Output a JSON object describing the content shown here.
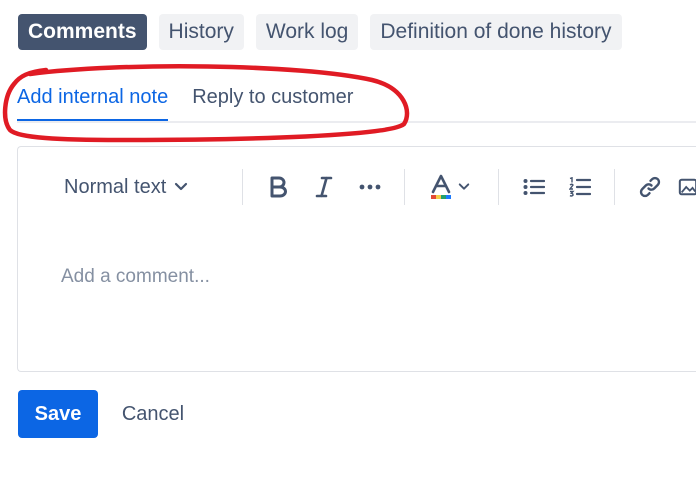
{
  "top_tabs": [
    {
      "label": "Comments",
      "active": true
    },
    {
      "label": "History",
      "active": false
    },
    {
      "label": "Work log",
      "active": false
    },
    {
      "label": "Definition of done history",
      "active": false
    }
  ],
  "sub_tabs": [
    {
      "label": "Add internal note",
      "active": true
    },
    {
      "label": "Reply to customer",
      "active": false
    }
  ],
  "editor": {
    "text_style": "Normal text",
    "placeholder": "Add a comment...",
    "toolbar_icons": [
      "chevron-down-icon",
      "bold-icon",
      "italic-icon",
      "more-icon",
      "text-color-icon",
      "bullet-list-icon",
      "numbered-list-icon",
      "link-icon",
      "image-icon"
    ]
  },
  "actions": {
    "save_label": "Save",
    "cancel_label": "Cancel"
  },
  "colors": {
    "accent": "#0c66e4",
    "highlight": "#e01b24",
    "active_tab_bg": "#44546f"
  }
}
